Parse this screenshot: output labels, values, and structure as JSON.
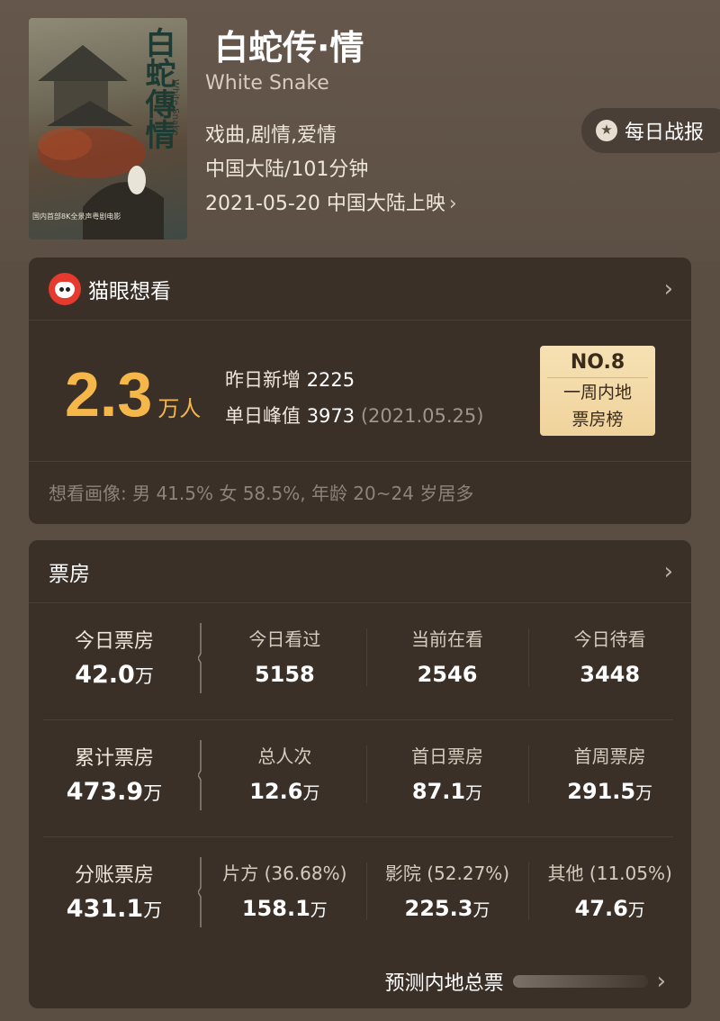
{
  "movie": {
    "title": "白蛇传·情",
    "title_en": "White Snake",
    "genres": "戏曲,剧情,爱情",
    "region_duration": "中国大陆/101分钟",
    "release": "2021-05-20 中国大陆上映",
    "poster": {
      "title_cn": "白蛇傳情",
      "title_en": "White Snake",
      "caption": "国内首部8K全景声粤剧电影"
    }
  },
  "daily_report": {
    "label": "每日战报",
    "icon": "medal-icon"
  },
  "want_card": {
    "title": "猫眼想看",
    "count": "2.3",
    "count_unit": "万人",
    "yesterday_label": "昨日新增",
    "yesterday_value": "2225",
    "peak_label": "单日峰值",
    "peak_value": "3973",
    "peak_date": "(2021.05.25)",
    "rank": {
      "no": "NO.8",
      "line1": "一周内地",
      "line2": "票房榜"
    },
    "portrait": "想看画像: 男 41.5%  女 58.5%,  年龄 20~24 岁居多"
  },
  "box_office": {
    "title": "票房",
    "rows": [
      {
        "label": "今日票房",
        "value": "42.0",
        "unit": "万",
        "cols": [
          {
            "label": "今日看过",
            "value": "5158",
            "unit": ""
          },
          {
            "label": "当前在看",
            "value": "2546",
            "unit": ""
          },
          {
            "label": "今日待看",
            "value": "3448",
            "unit": ""
          }
        ]
      },
      {
        "label": "累计票房",
        "value": "473.9",
        "unit": "万",
        "cols": [
          {
            "label": "总人次",
            "value": "12.6",
            "unit": "万"
          },
          {
            "label": "首日票房",
            "value": "87.1",
            "unit": "万"
          },
          {
            "label": "首周票房",
            "value": "291.5",
            "unit": "万"
          }
        ]
      },
      {
        "label": "分账票房",
        "value": "431.1",
        "unit": "万",
        "cols": [
          {
            "label": "片方 (36.68%)",
            "value": "158.1",
            "unit": "万"
          },
          {
            "label": "影院 (52.27%)",
            "value": "225.3",
            "unit": "万"
          },
          {
            "label": "其他 (11.05%)",
            "value": "47.6",
            "unit": "万"
          }
        ]
      }
    ],
    "forecast_label": "预测内地总票"
  }
}
